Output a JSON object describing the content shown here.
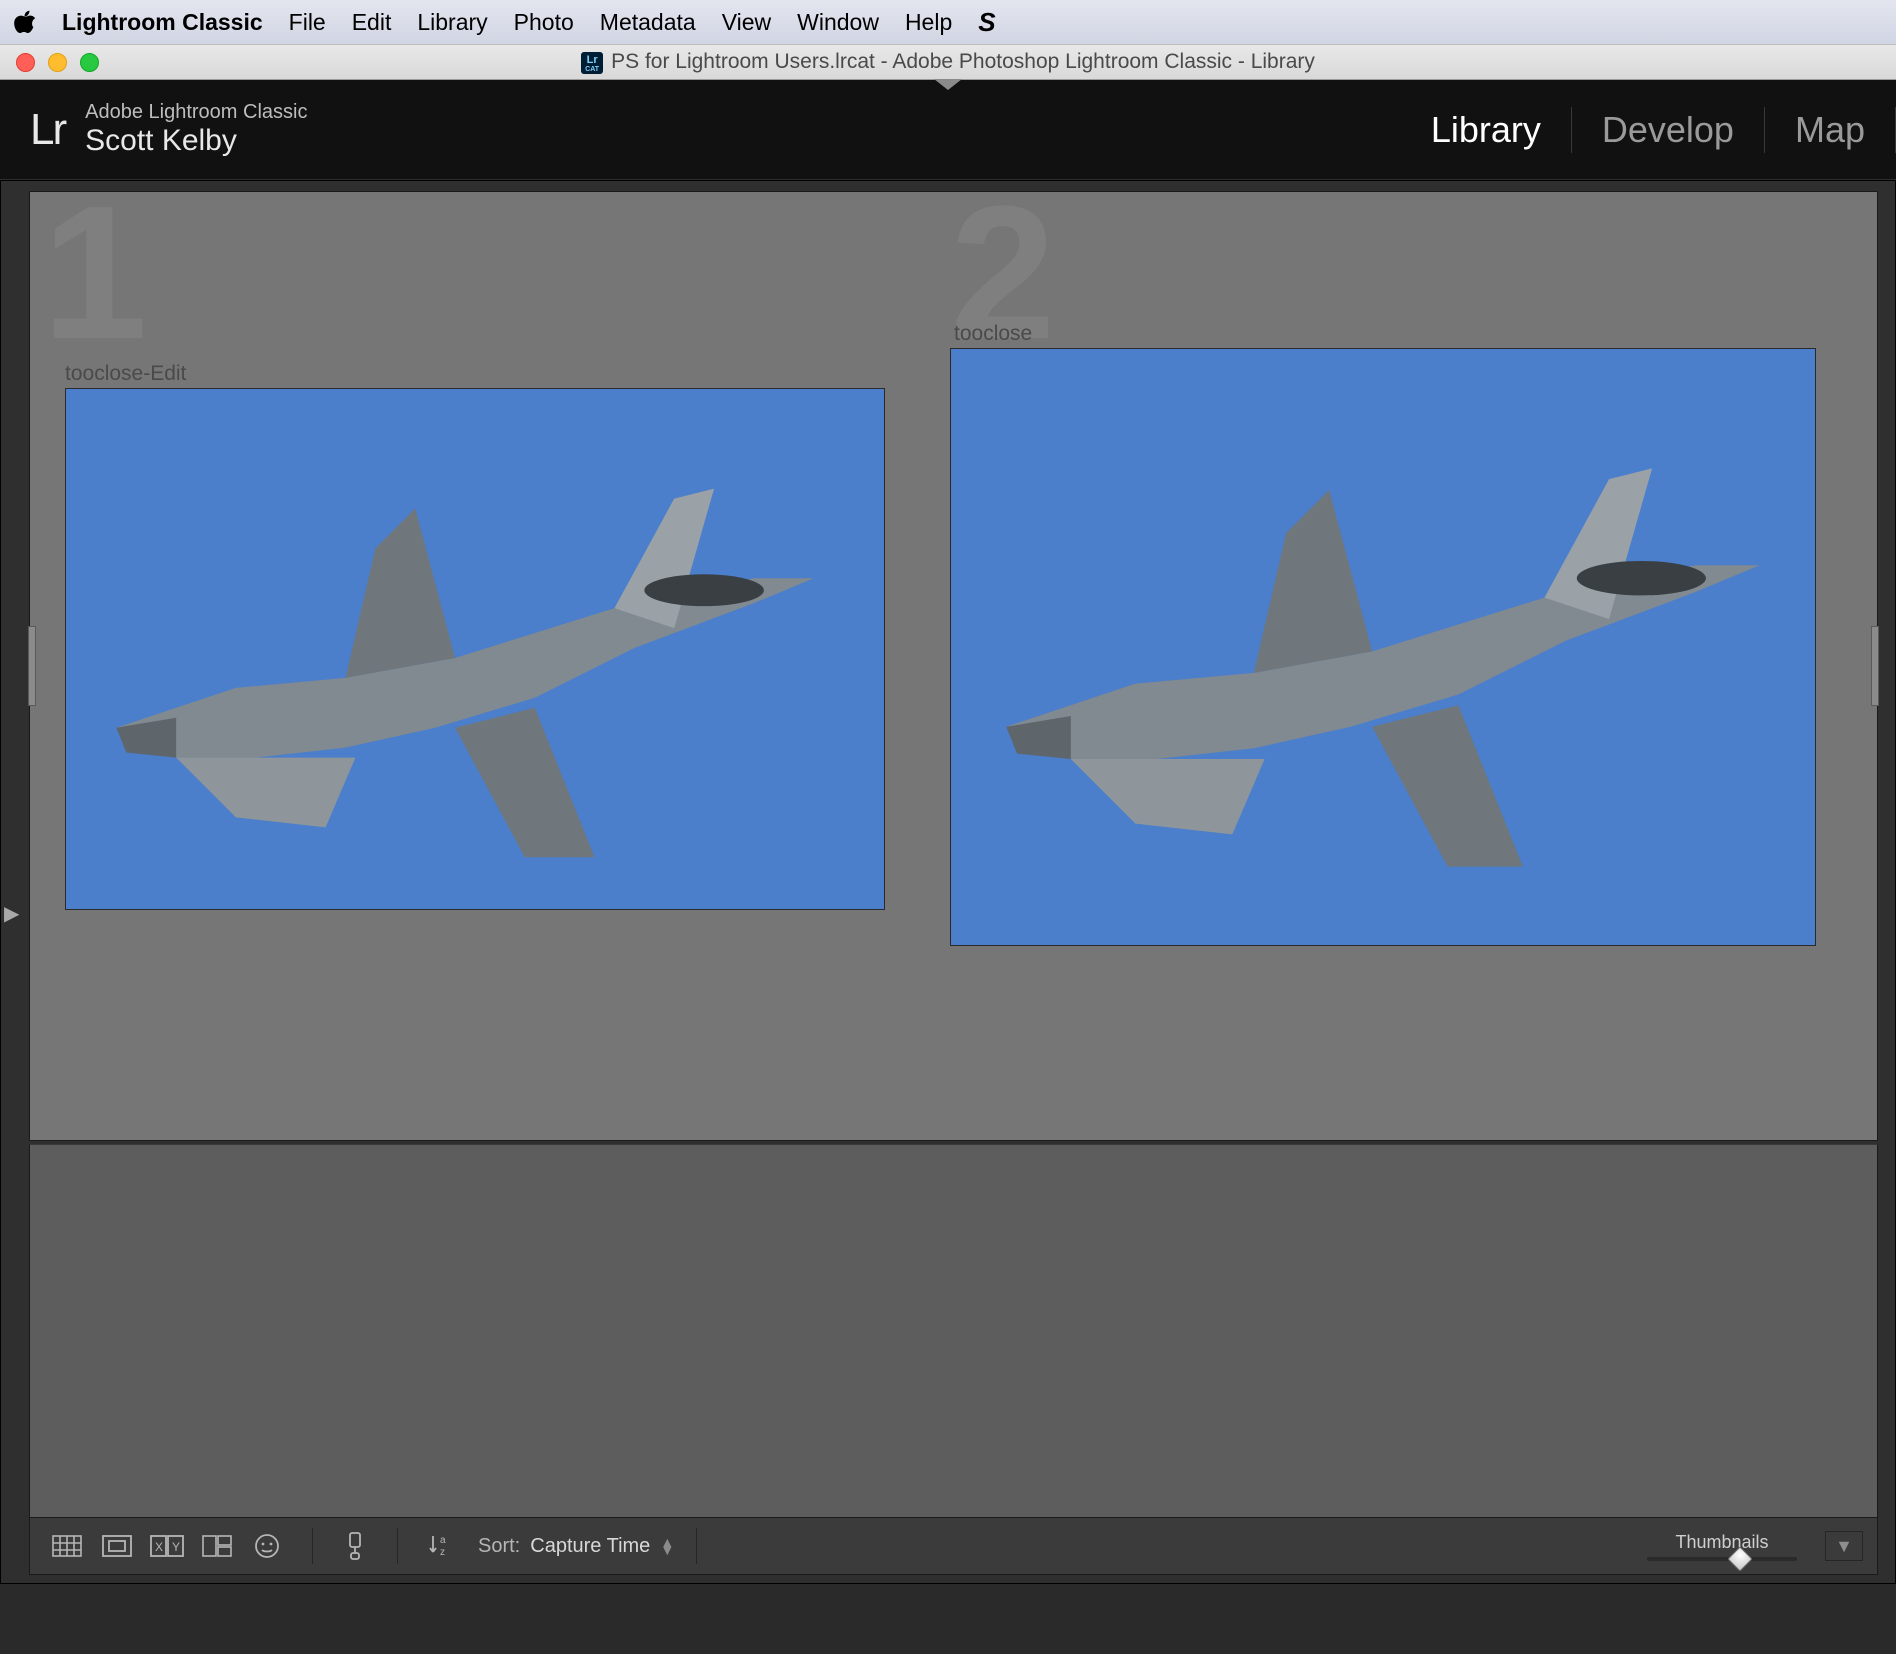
{
  "mac_menu": {
    "app_name": "Lightroom Classic",
    "items": [
      "File",
      "Edit",
      "Library",
      "Photo",
      "Metadata",
      "View",
      "Window",
      "Help"
    ]
  },
  "window": {
    "title": "PS for Lightroom Users.lrcat - Adobe Photoshop Lightroom Classic - Library"
  },
  "header": {
    "product": "Adobe Lightroom Classic",
    "user": "Scott Kelby",
    "modules": [
      {
        "label": "Library",
        "active": true
      },
      {
        "label": "Develop",
        "active": false
      },
      {
        "label": "Map",
        "active": false
      }
    ]
  },
  "compare": {
    "panes": [
      {
        "number": "1",
        "label": "tooclose-Edit"
      },
      {
        "number": "2",
        "label": "tooclose"
      }
    ]
  },
  "toolbar": {
    "sort_label": "Sort:",
    "sort_value": "Capture Time",
    "thumbnails_label": "Thumbnails",
    "thumbnails_pos": 0.62
  }
}
